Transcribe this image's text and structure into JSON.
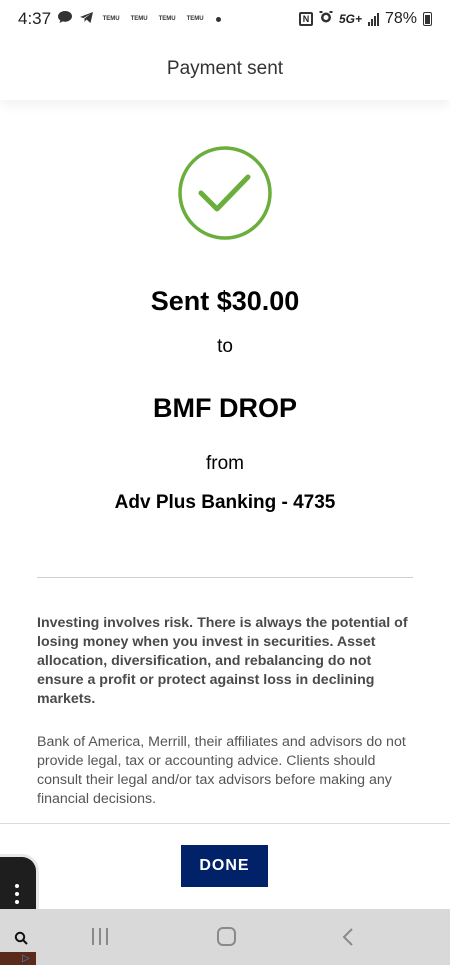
{
  "status_bar": {
    "time": "4:37",
    "app_badges": [
      "TEMU",
      "TEMU",
      "TEMU",
      "TEMU"
    ],
    "network": "5G+",
    "battery": "78%"
  },
  "header": {
    "title": "Payment sent"
  },
  "confirmation": {
    "amount_text": "Sent $30.00",
    "to_label": "to",
    "recipient": "BMF DROP",
    "from_label": "from",
    "account": "Adv Plus Banking - 4735"
  },
  "disclaimers": {
    "investing": "Investing involves risk. There is always the potential of losing money when you invest in securities. Asset allocation, diversification, and rebalancing do not ensure a profit or protect against loss in declining markets.",
    "advice": "Bank of America, Merrill, their affiliates and advisors do not provide legal, tax or accounting advice. Clients should consult their legal and/or tax advisors before making any financial decisions."
  },
  "actions": {
    "done_label": "DONE"
  },
  "colors": {
    "success_green": "#6aae3c",
    "brand_navy": "#012169"
  },
  "icons": {
    "success": "checkmark-circle-icon",
    "nav_recents": "recents-icon",
    "nav_home": "home-icon",
    "nav_back": "back-icon"
  }
}
